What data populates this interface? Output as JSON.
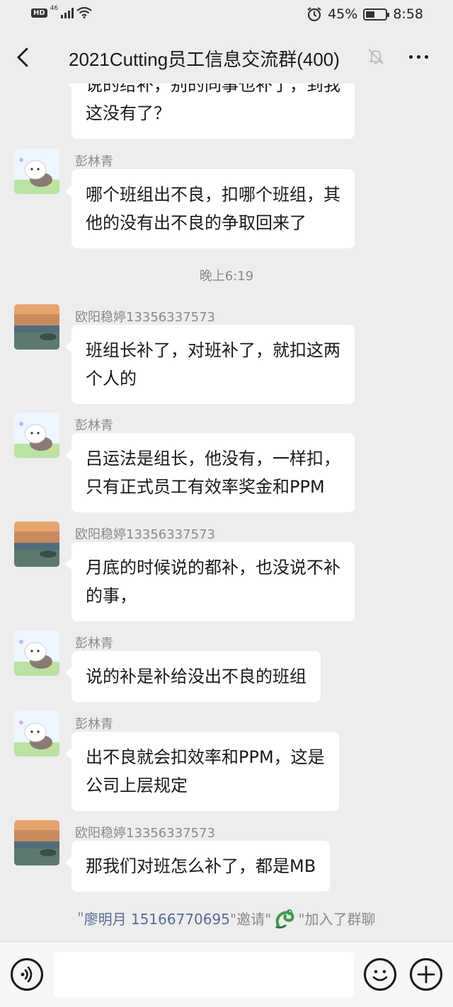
{
  "status_bar": {
    "hd": "HD",
    "network": "46",
    "battery_percent": "45%",
    "battery_level": 0.45,
    "time": "8:58"
  },
  "nav": {
    "title": "2021Cutting员工信息交流群(400)"
  },
  "messages": [
    {
      "type": "text",
      "sender": "",
      "lines": [
        "说的给补，别的同事也补了，到我",
        "这没有了？"
      ]
    },
    {
      "type": "text",
      "sender": "彭林青",
      "avatar": "cat-avatar",
      "lines": [
        "哪个班组出不良，扣哪个班组，其",
        "他的没有出不良的争取回来了"
      ]
    },
    {
      "type": "time",
      "text": "晚上6:19"
    },
    {
      "type": "text",
      "sender": "欧阳稳婷13356337573",
      "avatar": "sunset-avatar",
      "lines": [
        "班组长补了，对班补了，就扣这两",
        "个人的"
      ]
    },
    {
      "type": "text",
      "sender": "彭林青",
      "avatar": "cat-avatar",
      "lines": [
        "吕运法是组长，他没有，一样扣，",
        "只有正式员工有效率奖金和PPM"
      ]
    },
    {
      "type": "text",
      "sender": "欧阳稳婷13356337573",
      "avatar": "sunset-avatar",
      "lines": [
        "月底的时候说的都补，也没说不补",
        "的事，"
      ]
    },
    {
      "type": "text",
      "sender": "彭林青",
      "avatar": "cat-avatar",
      "lines": [
        "说的补是补给没出不良的班组"
      ]
    },
    {
      "type": "text",
      "sender": "彭林青",
      "avatar": "cat-avatar",
      "lines": [
        "出不良就会扣效率和PPM，这是",
        "公司上层规定"
      ]
    },
    {
      "type": "text",
      "sender": "欧阳稳婷13356337573",
      "avatar": "sunset-avatar",
      "lines": [
        "那我们对班怎么补了，都是MB"
      ]
    }
  ],
  "system_message": {
    "quote_open": "\"",
    "inviter": "廖明月 15166770695",
    "mid": "\"邀请\"",
    "emoji_icon": "dragon-icon",
    "suffix": "\"加入了群聊"
  },
  "input_bar": {
    "placeholder": ""
  },
  "colors": {
    "background": "#ededed",
    "bubble": "#ffffff",
    "link": "#576b95",
    "meta_text": "#8a8a8a"
  }
}
